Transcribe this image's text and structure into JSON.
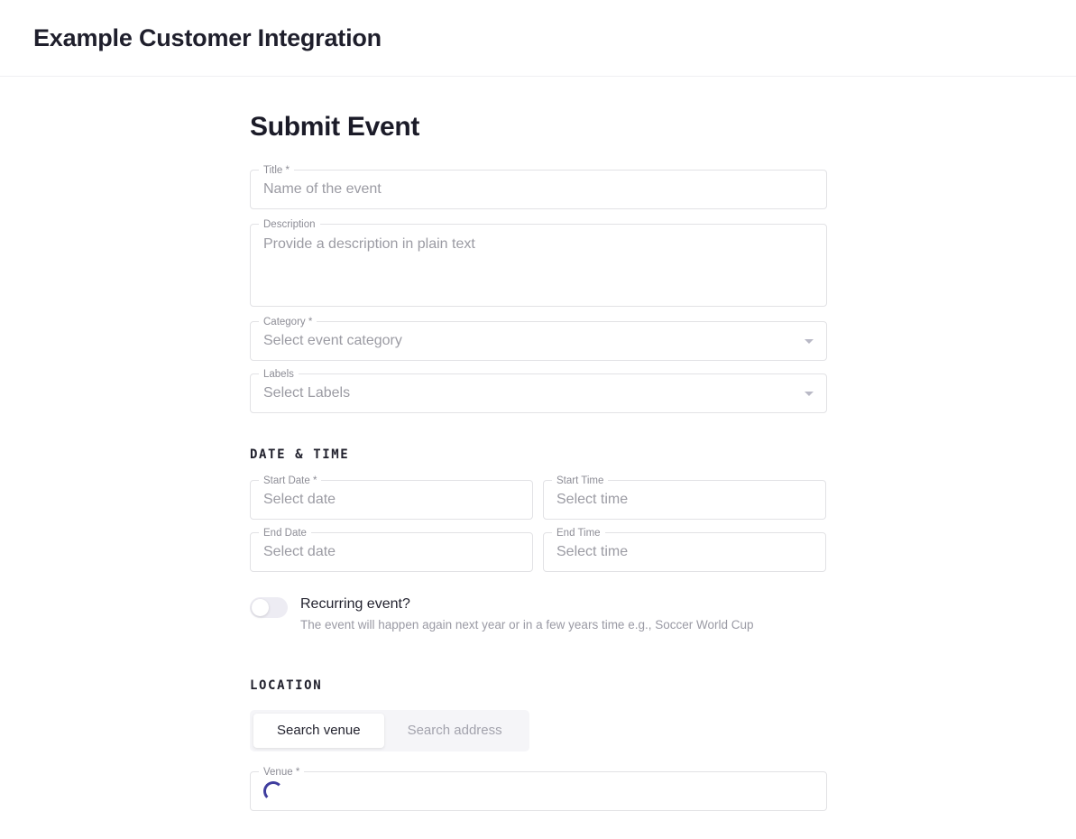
{
  "header": {
    "title": "Example Customer Integration"
  },
  "page": {
    "title": "Submit Event"
  },
  "fields": {
    "title": {
      "label": "Title *",
      "placeholder": "Name of the event"
    },
    "description": {
      "label": "Description",
      "placeholder": "Provide a description in plain text"
    },
    "category": {
      "label": "Category *",
      "placeholder": "Select event category",
      "icon": "chevron-down-icon"
    },
    "labels": {
      "label": "Labels",
      "placeholder": "Select Labels",
      "icon": "chevron-down-icon"
    },
    "start_date": {
      "label": "Start Date *",
      "placeholder": "Select date"
    },
    "start_time": {
      "label": "Start Time",
      "placeholder": "Select time"
    },
    "end_date": {
      "label": "End Date",
      "placeholder": "Select date"
    },
    "end_time": {
      "label": "End Time",
      "placeholder": "Select time"
    },
    "venue": {
      "label": "Venue *",
      "placeholder": ""
    }
  },
  "sections": {
    "date_time": "DATE & TIME",
    "location": "LOCATION"
  },
  "recurring": {
    "label": "Recurring event?",
    "help": "The event will happen again next year or in a few years time e.g., Soccer World Cup",
    "checked": false
  },
  "location_tabs": [
    {
      "label": "Search venue",
      "active": true
    },
    {
      "label": "Search address",
      "active": false
    }
  ],
  "colors": {
    "accent": "#3f3d9e",
    "border": "#e2e2e5",
    "placeholder": "#9b9ba3",
    "label": "#8d8d96",
    "text": "#1f1f2c",
    "track": "#f5f5f8"
  }
}
